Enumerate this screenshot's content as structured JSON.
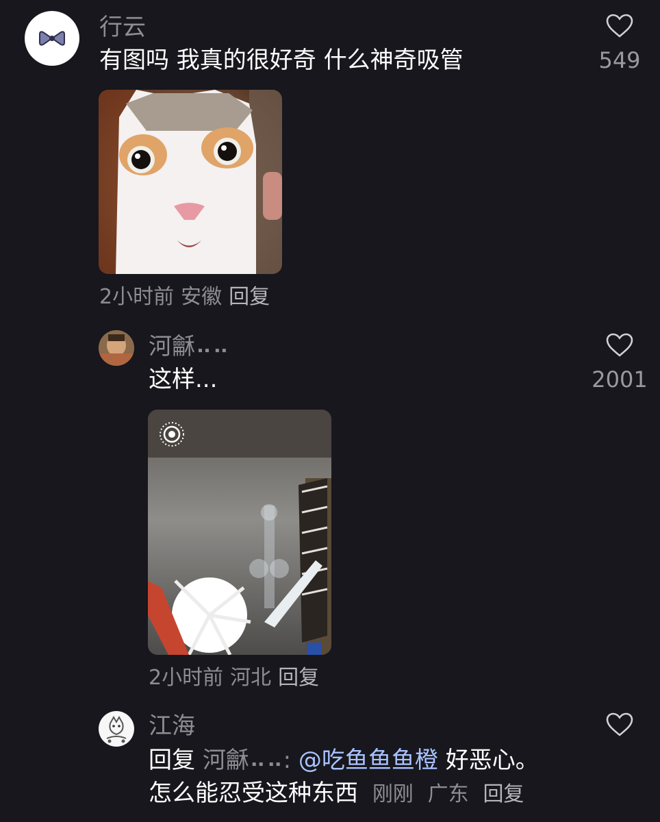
{
  "comments": [
    {
      "username": "行云",
      "text": "有图吗 我真的很好奇 什么神奇吸管",
      "likes": "549",
      "time": "2小时前",
      "location": "安徽",
      "reply_label": "回复",
      "avatar_icon": "bow-icon"
    },
    {
      "username": "河龢⠤⠤",
      "text": "这样...",
      "likes": "2001",
      "time": "2小时前",
      "location": "河北",
      "reply_label": "回复",
      "live_photo_icon": "live-photo-icon"
    },
    {
      "username": "江海",
      "reply_prefix": "回复",
      "reply_to": "河龢⠤⠤:",
      "mention": "@吃鱼鱼鱼橙",
      "text_line1_rest": " 好恶心。",
      "text_line2": "怎么能忍受这种东西",
      "time": "刚刚",
      "location": "广东",
      "reply_label": "回复"
    }
  ],
  "colors": {
    "background": "#17171d",
    "muted_text": "#8d8d93",
    "mention": "#a9c3ff"
  }
}
